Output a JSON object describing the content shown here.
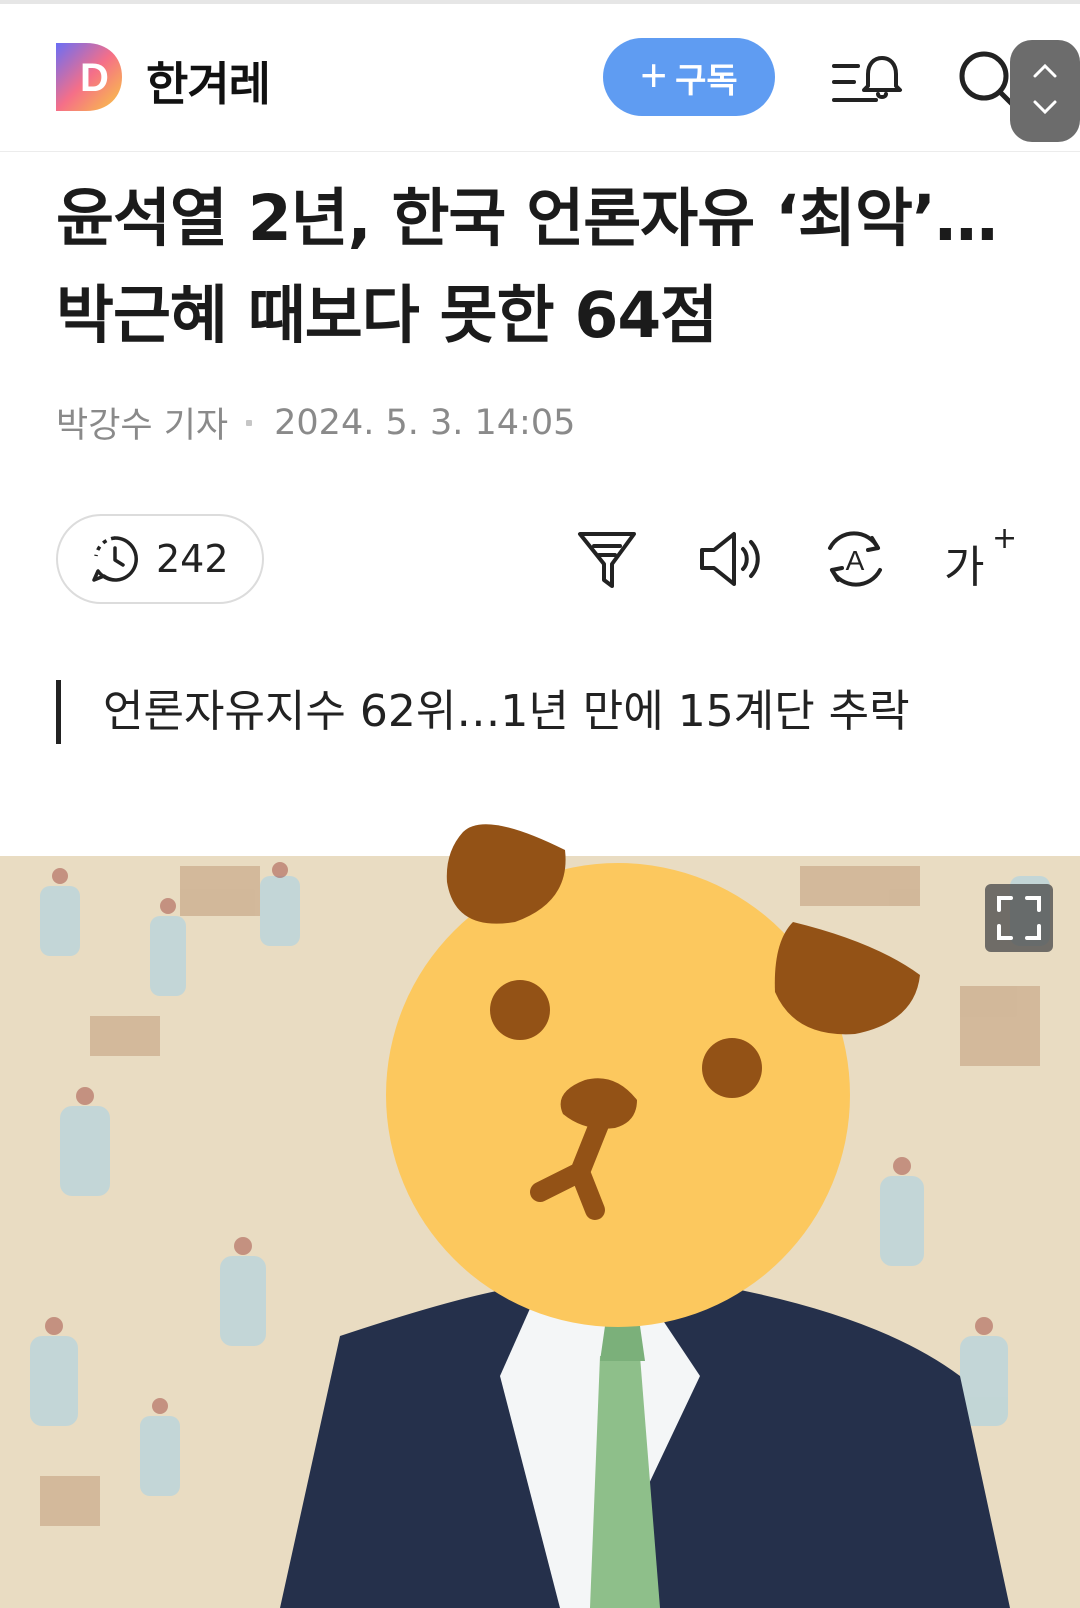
{
  "header": {
    "logo_letter": "D",
    "brand": "한겨레",
    "subscribe_plus": "+",
    "subscribe_label": "구독",
    "menu_icon": "menu-bell-icon",
    "search_icon": "search-icon"
  },
  "article": {
    "title_line1": "윤석열 2년, 한국 언론자유 ‘최악’…",
    "title_line2": "박근혜 때보다 못한 64점",
    "author": "박강수 기자",
    "datetime": "2024. 5. 3. 14:05",
    "comment_count": "242",
    "subhead": "언론자유지수 62위…1년 만에 15계단 추락"
  },
  "toolbar": {
    "summary_icon": "filter-icon",
    "listen_icon": "speaker-icon",
    "translate_icon": "translate-icon",
    "font_label": "가",
    "font_plus": "+"
  },
  "colors": {
    "subscribe_bg": "#5f9cf2",
    "text_main": "#1b1b1b",
    "text_meta": "#8a8a8a",
    "sticker_face": "#fcc85e",
    "sticker_brown": "#935216",
    "photo_bg": "#e9dcc2"
  }
}
